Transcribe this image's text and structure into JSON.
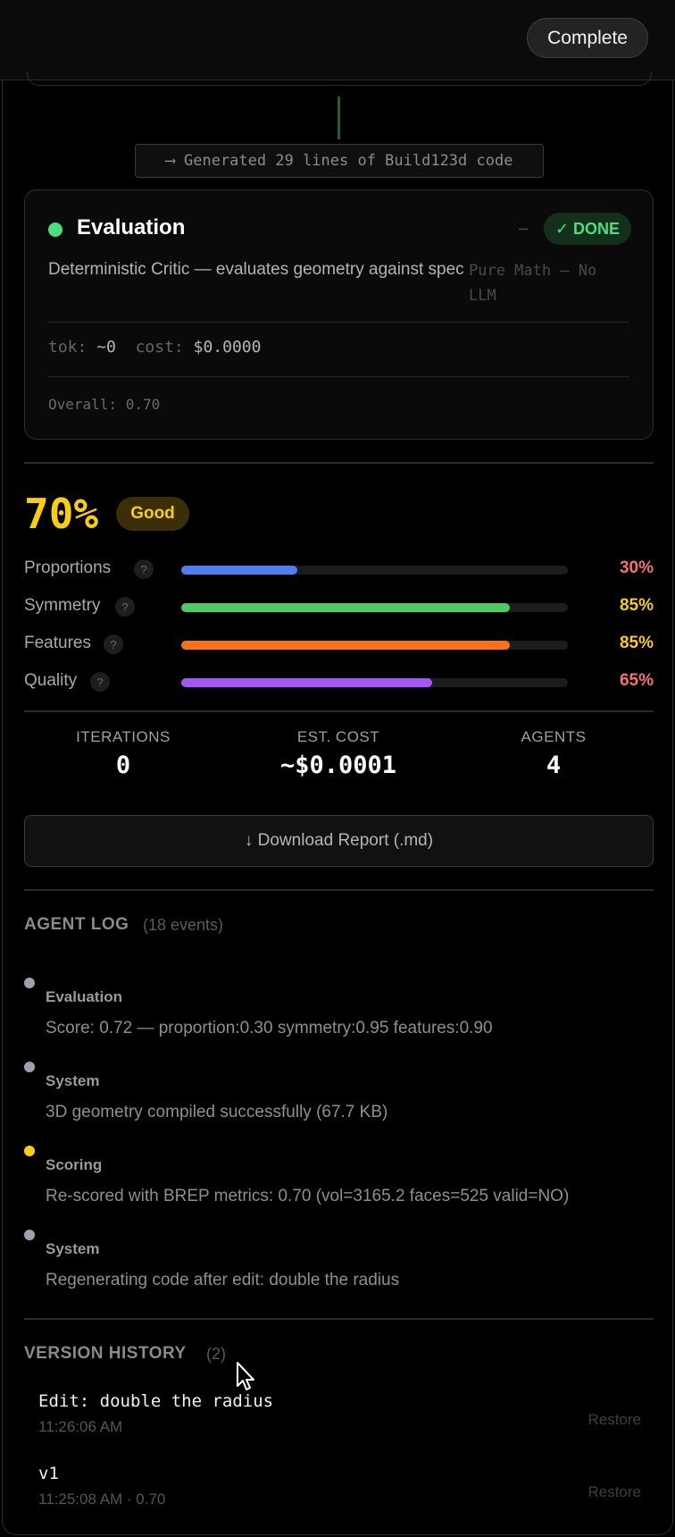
{
  "header": {
    "complete_label": "Complete"
  },
  "generated_note": "⟶ Generated 29 lines of Build123d code",
  "evaluation_card": {
    "title": "Evaluation",
    "dash": "–",
    "status": "✓ DONE",
    "description": "Deterministic Critic — evaluates geometry against spec",
    "side_note": "Pure Math — No LLM",
    "tok_label": "tok:",
    "tok_value": "~0",
    "cost_label": "cost:",
    "cost_value": "$0.0000",
    "overall": "Overall: 0.70",
    "colors": {
      "status_dot": "#4ade80"
    }
  },
  "score": {
    "value": "70%",
    "badge": "Good",
    "metrics": [
      {
        "label": "Proportions",
        "help": "?",
        "percent": 30,
        "percent_text": "30%",
        "bar_color": "#4f7df3",
        "text_color": "#f87171"
      },
      {
        "label": "Symmetry",
        "help": "?",
        "percent": 85,
        "percent_text": "85%",
        "bar_color": "#4ecb63",
        "text_color": "#facc15"
      },
      {
        "label": "Features",
        "help": "?",
        "percent": 85,
        "percent_text": "85%",
        "bar_color": "#f97316",
        "text_color": "#facc15"
      },
      {
        "label": "Quality",
        "help": "?",
        "percent": 65,
        "percent_text": "65%",
        "bar_color": "#a855f7",
        "text_color": "#f87171"
      }
    ]
  },
  "stats": [
    {
      "label": "ITERATIONS",
      "value": "0"
    },
    {
      "label": "EST. COST",
      "value": "~$0.0001"
    },
    {
      "label": "AGENTS",
      "value": "4"
    }
  ],
  "download_label": "↓ Download Report (.md)",
  "agent_log": {
    "title": "AGENT LOG",
    "count": "(18 events)",
    "entries": [
      {
        "agent": "Evaluation",
        "message": "Score: 0.72 — proportion:0.30 symmetry:0.95 features:0.90",
        "dot_color": "#9ca3af"
      },
      {
        "agent": "System",
        "message": "3D geometry compiled successfully (67.7 KB)",
        "dot_color": "#9ca3af"
      },
      {
        "agent": "Scoring",
        "message": "Re-scored with BREP metrics: 0.70 (vol=3165.2 faces=525 valid=NO)",
        "dot_color": "#facc15"
      },
      {
        "agent": "System",
        "message": "Regenerating code after edit: double the radius",
        "dot_color": "#9ca3af"
      }
    ]
  },
  "version_history": {
    "title": "VERSION HISTORY",
    "count": "(2)",
    "items": [
      {
        "label": "Edit: double the radius",
        "meta": "11:26:06 AM",
        "action": "Restore"
      },
      {
        "label": "v1",
        "meta": "11:25:08 AM · 0.70",
        "action": "Restore"
      }
    ]
  }
}
